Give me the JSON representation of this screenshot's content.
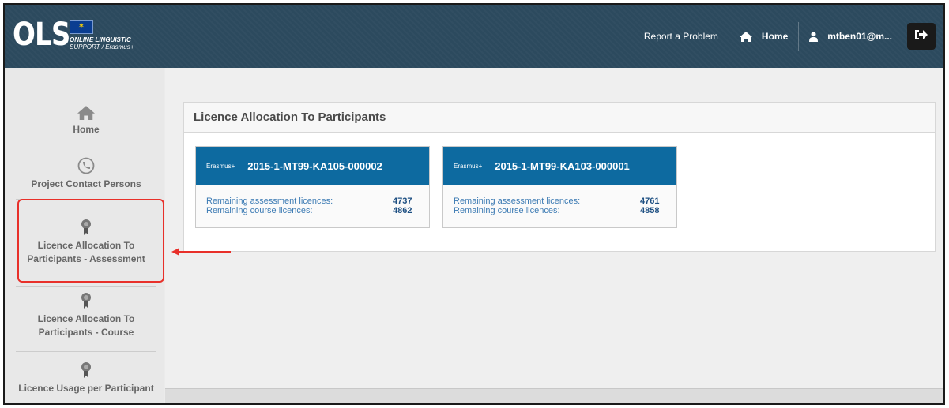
{
  "header": {
    "logo_text": "OLS",
    "logo_line1": "ONLINE LINGUISTIC",
    "logo_line2": "SUPPORT / Erasmus+",
    "nav": {
      "report": "Report a Problem",
      "home": "Home",
      "user": "mtben01@m..."
    }
  },
  "sidebar": {
    "items": [
      {
        "label": "Home",
        "icon": "home-icon"
      },
      {
        "label": "Project Contact Persons",
        "icon": "phone-icon"
      },
      {
        "label_line1": "Licence Allocation To",
        "label_line2": "Participants - Assessment",
        "icon": "award-icon"
      },
      {
        "label_line1": "Licence Allocation To",
        "label_line2": "Participants - Course",
        "icon": "award-icon"
      },
      {
        "label": "Licence Usage per Participant",
        "icon": "award-icon"
      }
    ]
  },
  "main": {
    "panel_title": "Licence Allocation To Participants",
    "cards": [
      {
        "brand": "Erasmus+",
        "code": "2015-1-MT99-KA105-000002",
        "rows": [
          {
            "label": "Remaining assessment licences:",
            "value": "4737"
          },
          {
            "label": "Remaining course licences:",
            "value": "4862"
          }
        ]
      },
      {
        "brand": "Erasmus+",
        "code": "2015-1-MT99-KA103-000001",
        "rows": [
          {
            "label": "Remaining assessment licences:",
            "value": "4761"
          },
          {
            "label": "Remaining course licences:",
            "value": "4858"
          }
        ]
      }
    ]
  },
  "colors": {
    "topbar": "#2c4a5e",
    "card_header": "#0d6aa0",
    "annotation": "#e8302a"
  }
}
